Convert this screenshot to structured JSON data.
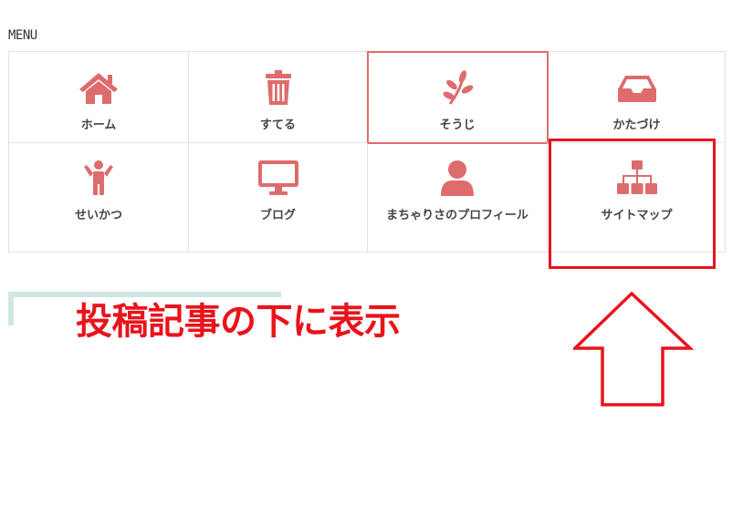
{
  "menu": {
    "heading": "MENU",
    "items": [
      {
        "label": "ホーム",
        "icon": "home-icon"
      },
      {
        "label": "すてる",
        "icon": "trash-icon"
      },
      {
        "label": "そうじ",
        "icon": "leaf-icon"
      },
      {
        "label": "かたづけ",
        "icon": "inbox-icon"
      },
      {
        "label": "せいかつ",
        "icon": "child-icon"
      },
      {
        "label": "ブログ",
        "icon": "desktop-icon"
      },
      {
        "label": "まちゃりさのプロフィール",
        "icon": "user-icon"
      },
      {
        "label": "サイトマップ",
        "icon": "sitemap-icon"
      }
    ],
    "active_item": "そうじ",
    "icon_color": "#de6c6c"
  },
  "annotation": {
    "text": "投稿記事の下に表示",
    "color": "#e8141c"
  },
  "accent_color": "#cfe6e3"
}
